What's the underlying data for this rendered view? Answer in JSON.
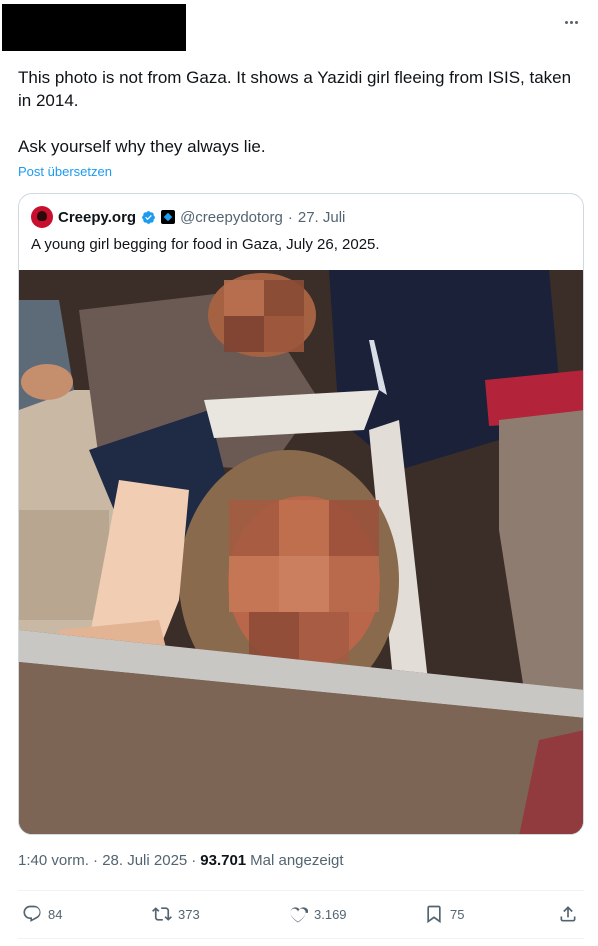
{
  "tweet": {
    "text": "This photo is not from Gaza. It shows a Yazidi girl fleeing from ISIS, taken in 2014.\n\nAsk yourself why they always lie.",
    "translate_label": "Post übersetzen",
    "timestamp": "1:40 vorm. · 28. Juli 2025",
    "views_count": "93.701",
    "views_label": "Mal angezeigt"
  },
  "quoted": {
    "name": "Creepy.org",
    "handle": "@creepydotorg",
    "separator": "·",
    "date": "27. Juli",
    "text": "A young girl begging for food in Gaza, July 26, 2025."
  },
  "actions": {
    "replies": "84",
    "reposts": "373",
    "likes": "3.169",
    "bookmarks": "75"
  },
  "colors": {
    "accent": "#1d9bf0",
    "secondary_text": "#536471",
    "border": "#cfd9de"
  },
  "icons": [
    "more-icon",
    "verified-badge-icon",
    "affiliate-badge-icon",
    "reply-icon",
    "repost-icon",
    "like-icon",
    "bookmark-icon",
    "share-icon"
  ]
}
